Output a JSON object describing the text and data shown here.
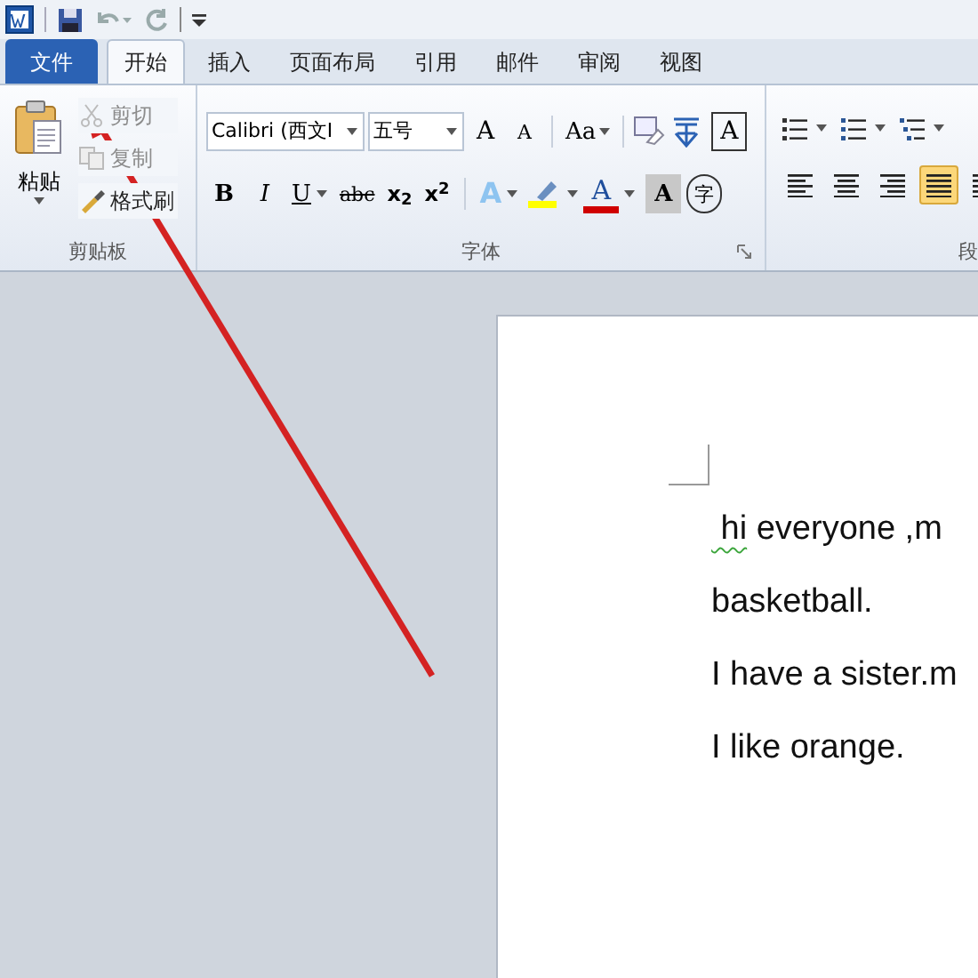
{
  "tabs": [
    {
      "label": "文件",
      "kind": "file",
      "selected": false
    },
    {
      "label": "开始",
      "kind": "tab",
      "selected": true
    },
    {
      "label": "插入",
      "kind": "tab",
      "selected": false
    },
    {
      "label": "页面布局",
      "kind": "tab",
      "selected": false
    },
    {
      "label": "引用",
      "kind": "tab",
      "selected": false
    },
    {
      "label": "邮件",
      "kind": "tab",
      "selected": false
    },
    {
      "label": "审阅",
      "kind": "tab",
      "selected": false
    },
    {
      "label": "视图",
      "kind": "tab",
      "selected": false
    }
  ],
  "clipboard": {
    "paste": "粘贴",
    "commands": [
      {
        "label": "剪切",
        "disabled": true
      },
      {
        "label": "复制",
        "disabled": true
      },
      {
        "label": "格式刷",
        "disabled": false
      }
    ],
    "group_label": "剪贴板"
  },
  "font": {
    "font_name": "Calibri (西文I",
    "font_size": "五号",
    "grow": "A",
    "shrink": "A",
    "change_case": "Aa",
    "char_border": "A",
    "bold": "B",
    "italic": "I",
    "underline": "U",
    "strikethrough": "abc",
    "subscript": "x$_{2}$",
    "superscript": "x$^{2}$",
    "text_effect": "A",
    "font_color": "A",
    "shading": "A",
    "enclosed": "字",
    "group_label": "字体"
  },
  "paragraph": {
    "alignment_buttons": [
      {
        "selected": false
      },
      {
        "selected": false
      },
      {
        "selected": false
      },
      {
        "selected": true
      },
      {
        "selected": false
      }
    ],
    "group_label": "段"
  },
  "document": {
    "lines": [
      {
        "segments": [
          {
            "text": " hi",
            "misspelled": true
          },
          {
            "text": " everyone ,m",
            "misspelled": false
          }
        ]
      },
      {
        "segments": [
          {
            "text": "basketball.",
            "misspelled": false
          }
        ]
      },
      {
        "segments": [
          {
            "text": "I have a sister.m",
            "misspelled": false
          }
        ]
      },
      {
        "segments": [
          {
            "text": "I like orange.",
            "misspelled": false
          }
        ]
      }
    ]
  }
}
